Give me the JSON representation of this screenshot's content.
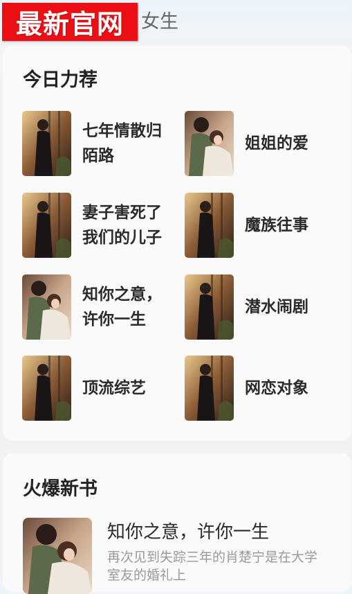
{
  "header": {
    "logo_text": "最新官网",
    "tab_label": "女生"
  },
  "recommend": {
    "title": "今日力荐",
    "books": [
      {
        "title": "七年情散归陌路",
        "cover": "cover-woman-window"
      },
      {
        "title": "姐姐的爱",
        "cover": "cover-couple"
      },
      {
        "title": "妻子害死了我们的儿子",
        "cover": "cover-woman-window"
      },
      {
        "title": "魔族往事",
        "cover": "cover-woman-window"
      },
      {
        "title": "知你之意，许你一生",
        "cover": "cover-couple"
      },
      {
        "title": "潜水闹剧",
        "cover": "cover-woman-window"
      },
      {
        "title": "顶流综艺",
        "cover": "cover-woman-window"
      },
      {
        "title": "网恋对象",
        "cover": "cover-woman-window"
      }
    ]
  },
  "hot": {
    "title": "火爆新书",
    "featured": {
      "title": "知你之意，许你一生",
      "description": "再次见到失踪三年的肖楚宁是在大学室友的婚礼上",
      "cover": "cover-couple"
    }
  }
}
